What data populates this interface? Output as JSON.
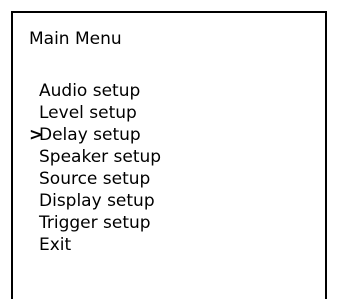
{
  "menu": {
    "title": "Main Menu",
    "cursor_symbol": ">",
    "selected_index": 2,
    "items": [
      {
        "label": "Audio setup"
      },
      {
        "label": "Level setup"
      },
      {
        "label": "Delay setup"
      },
      {
        "label": "Speaker setup"
      },
      {
        "label": "Source setup"
      },
      {
        "label": "Display setup"
      },
      {
        "label": "Trigger setup"
      },
      {
        "label": "Exit"
      }
    ]
  },
  "colors": {
    "background": "#ffffff",
    "text": "#000000",
    "border": "#000000"
  }
}
